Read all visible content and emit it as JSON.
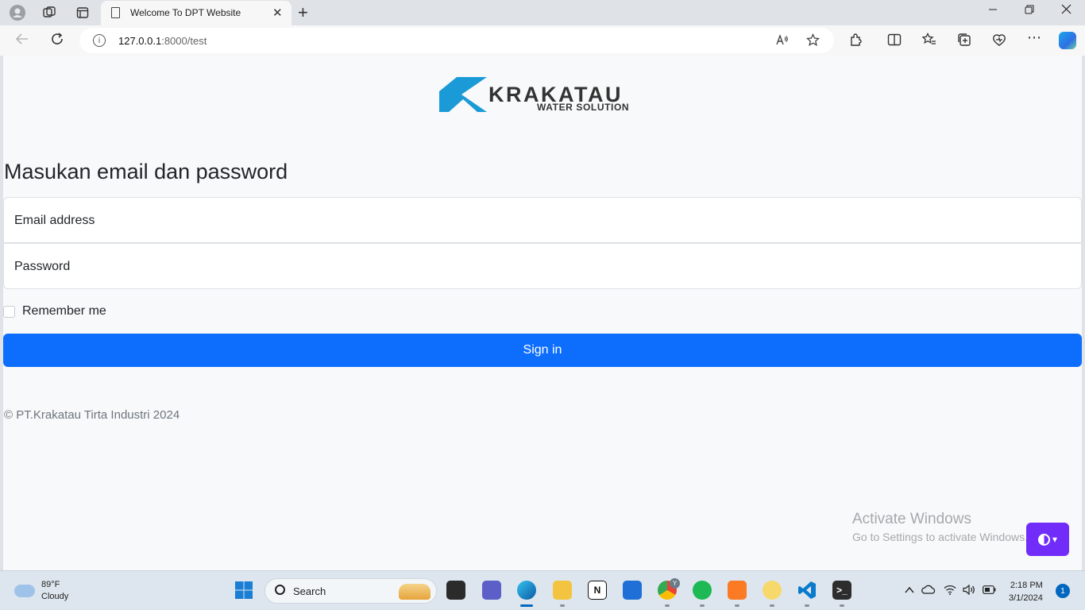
{
  "browser": {
    "tab_title": "Welcome To DPT Website",
    "tab_close_glyph": "✕",
    "new_tab_glyph": "+",
    "url_host": "127.0.0.1",
    "url_rest": ":8000/test"
  },
  "page": {
    "logo_brand": "KRAKATAU",
    "logo_tagline": "WATER SOLUTION",
    "heading": "Masukan email dan password",
    "email_label": "Email address",
    "password_label": "Password",
    "remember_label": "Remember me",
    "signin_label": "Sign in",
    "footer": "© PT.Krakatau Tirta Industri 2024"
  },
  "watermark": {
    "line1": "Activate Windows",
    "line2": "Go to Settings to activate Windows."
  },
  "taskbar": {
    "weather_temp": "89°F",
    "weather_desc": "Cloudy",
    "search_placeholder": "Search",
    "time": "2:18 PM",
    "date": "3/1/2024",
    "notification_count": "1",
    "chrome_badge": "Y"
  },
  "colors": {
    "primary": "#0d6efd",
    "theme_button": "#712cf9",
    "logo_blue": "#1a9bd7",
    "logo_text": "#333333"
  }
}
